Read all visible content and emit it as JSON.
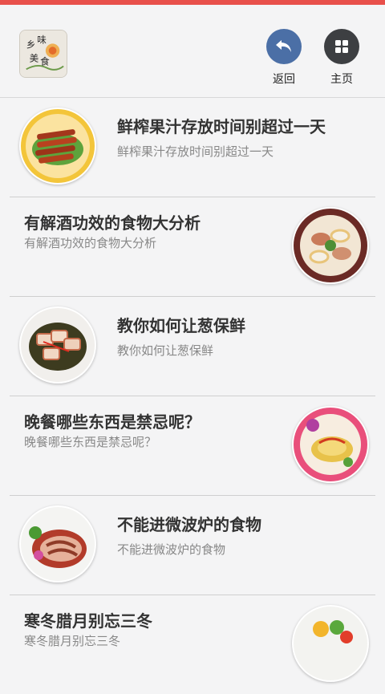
{
  "header": {
    "logo_text": "乡味美食",
    "back_label": "返回",
    "home_label": "主页"
  },
  "articles": [
    {
      "title": "鲜榨果汁存放时间别超过一天",
      "subtitle": "鲜榨果汁存放时间别超过一天",
      "layout": "left"
    },
    {
      "title": "有解酒功效的食物大分析",
      "subtitle": "有解酒功效的食物大分析",
      "layout": "right"
    },
    {
      "title": "教你如何让葱保鲜",
      "subtitle": "教你如何让葱保鲜",
      "layout": "left"
    },
    {
      "title": "晚餐哪些东西是禁忌呢？",
      "subtitle": "晚餐哪些东西是禁忌呢？",
      "layout": "right"
    },
    {
      "title": "不能进微波炉的食物",
      "subtitle": "不能进微波炉的食物",
      "layout": "left"
    },
    {
      "title": "寒冬腊月别忘三冬",
      "subtitle": "寒冬腊月别忘三冬",
      "layout": "right"
    }
  ],
  "colors": {
    "top_accent": "#e8504b",
    "back_button": "#4b6fa6",
    "home_button": "#3d3f42"
  }
}
